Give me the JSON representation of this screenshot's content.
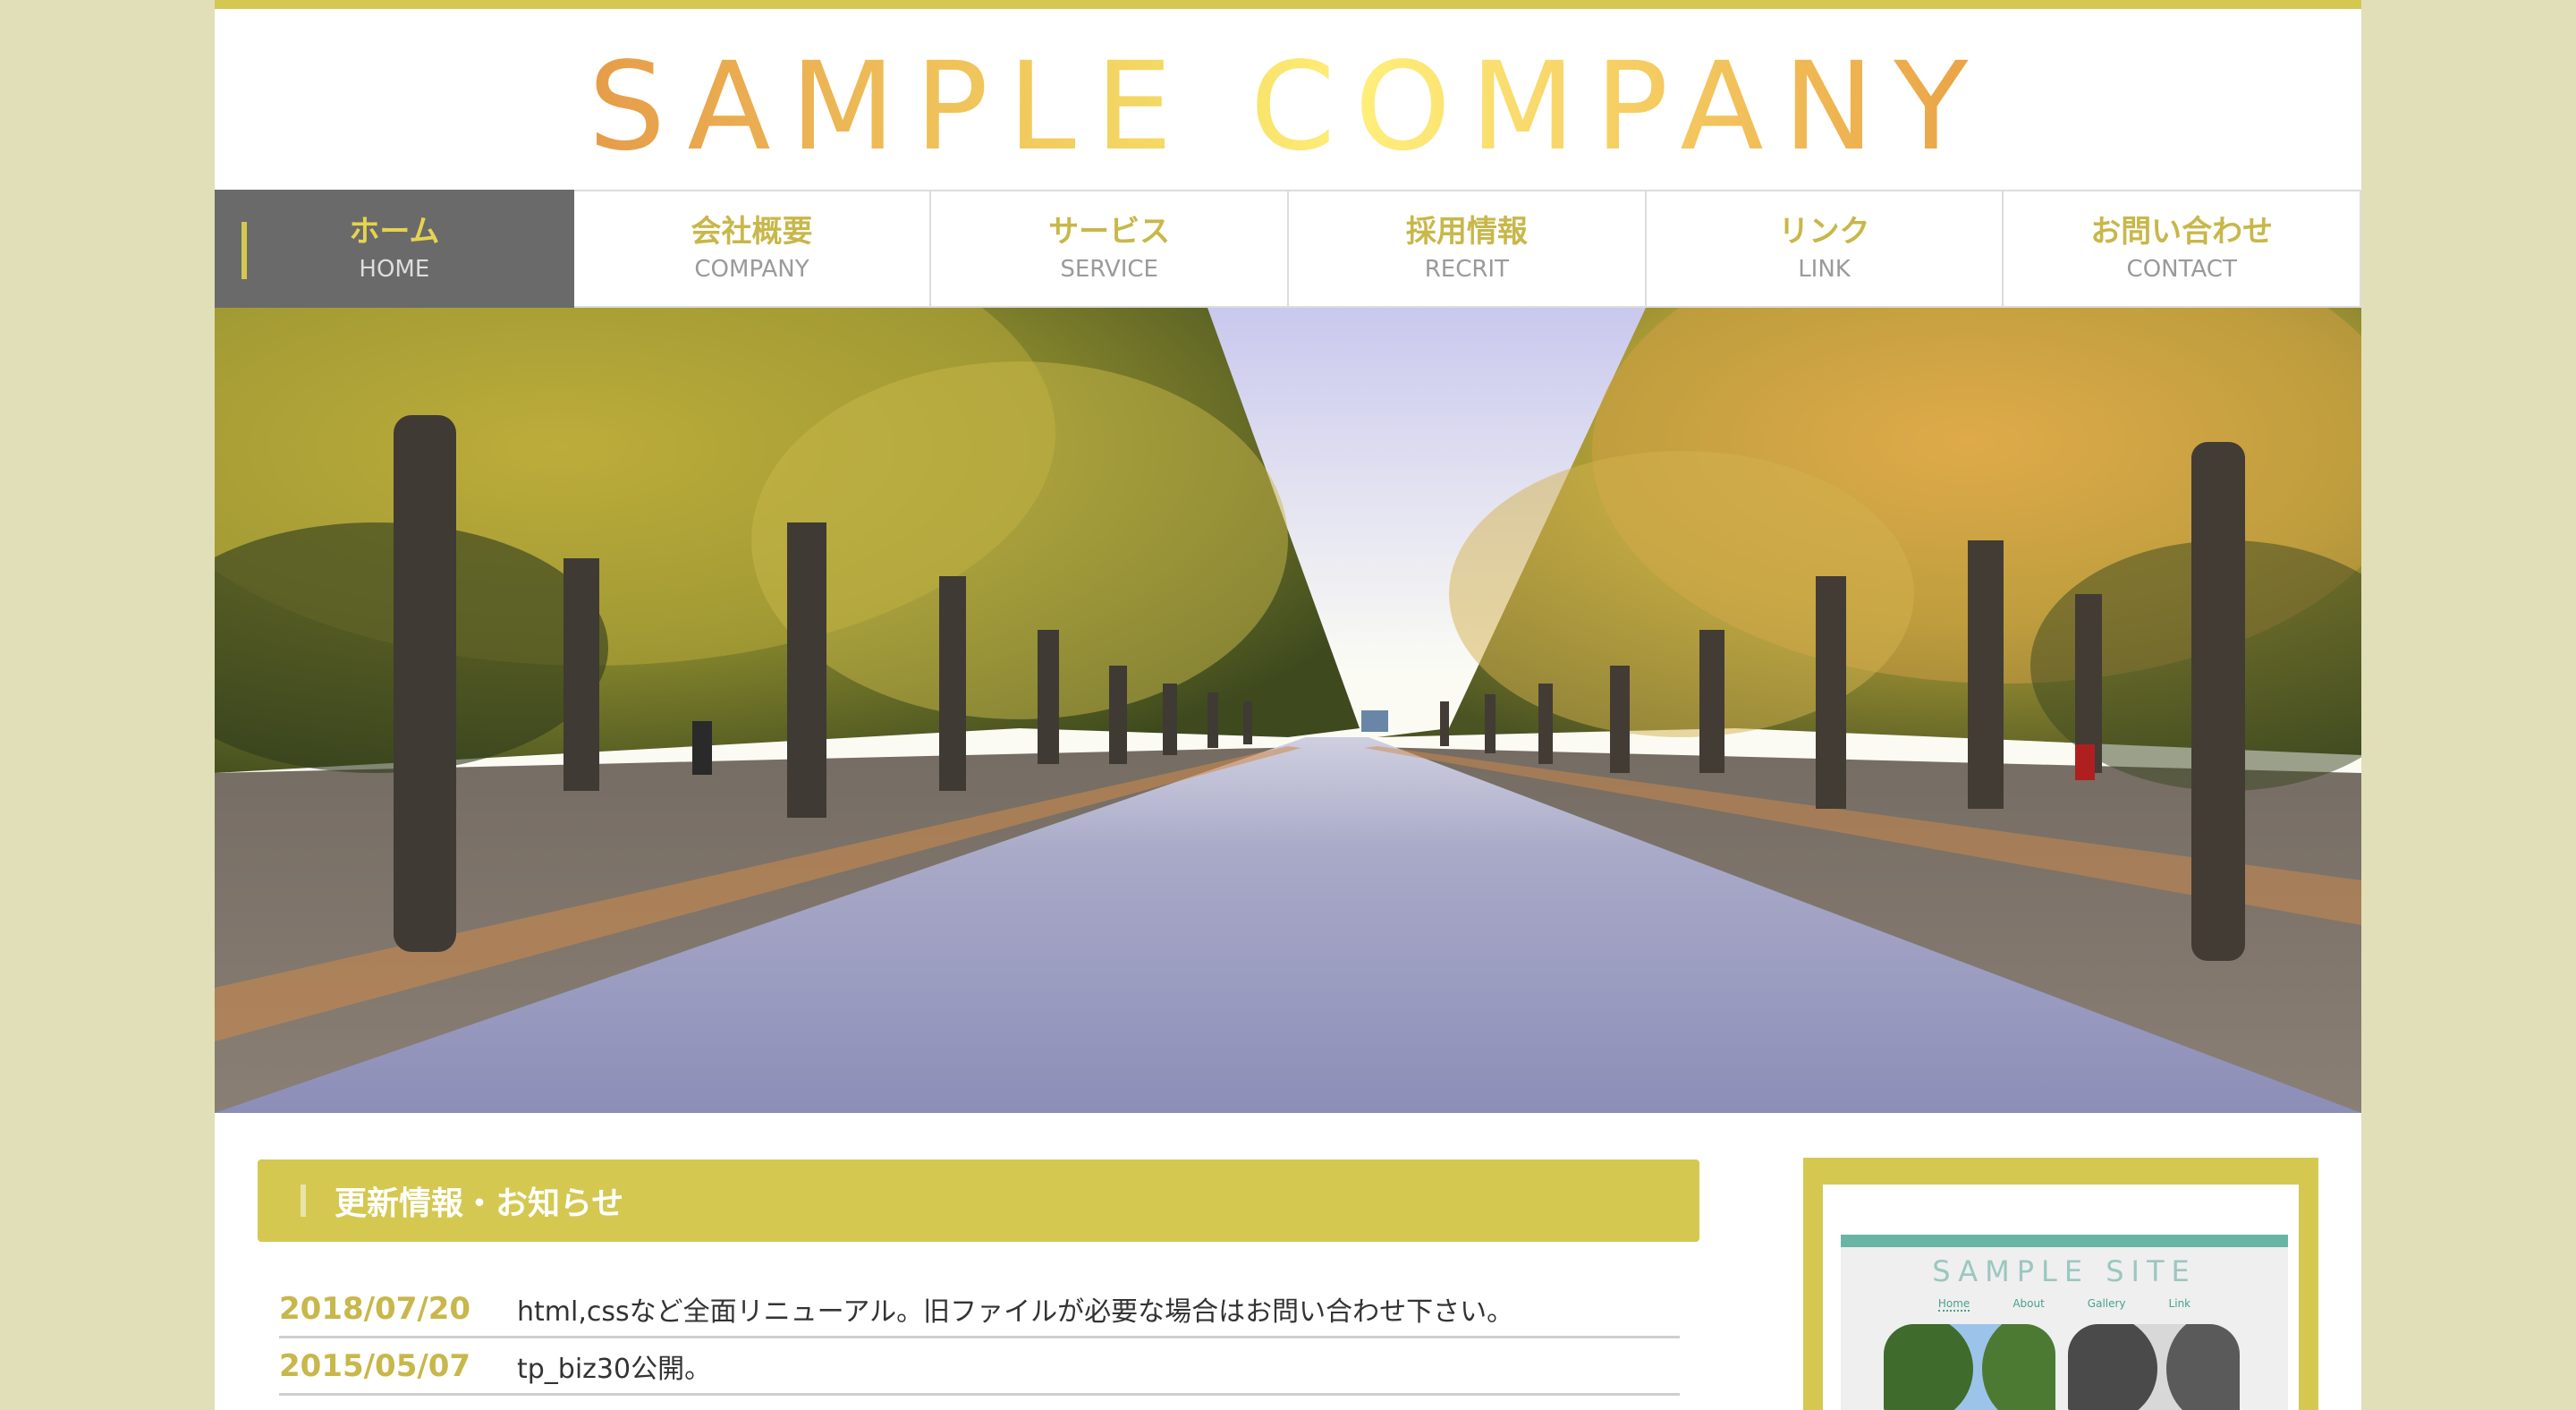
{
  "site": {
    "logo": "SAMPLE COMPANY",
    "accent_color": "#d4c851",
    "background_color": "#e0dfb7"
  },
  "nav": {
    "items": [
      {
        "jp": "ホーム",
        "en": "HOME",
        "active": true
      },
      {
        "jp": "会社概要",
        "en": "COMPANY"
      },
      {
        "jp": "サービス",
        "en": "SERVICE"
      },
      {
        "jp": "採用情報",
        "en": "RECRIT"
      },
      {
        "jp": "リンク",
        "en": "LINK"
      },
      {
        "jp": "お問い合わせ",
        "en": "CONTACT"
      }
    ]
  },
  "hero": {
    "image": "tree-lined-autumn-avenue-photo"
  },
  "news": {
    "heading": "更新情報・お知らせ",
    "items": [
      {
        "date": "2018/07/20",
        "text": "html,cssなど全面リニューアル。旧ファイルが必要な場合はお問い合わせ下さい。"
      },
      {
        "date": "2015/05/07",
        "text": "tp_biz30公開。"
      }
    ]
  },
  "sidebar": {
    "banner": {
      "site_title": "SAMPLE SITE",
      "nav": [
        "Home",
        "About",
        "Gallery",
        "Link"
      ]
    }
  }
}
